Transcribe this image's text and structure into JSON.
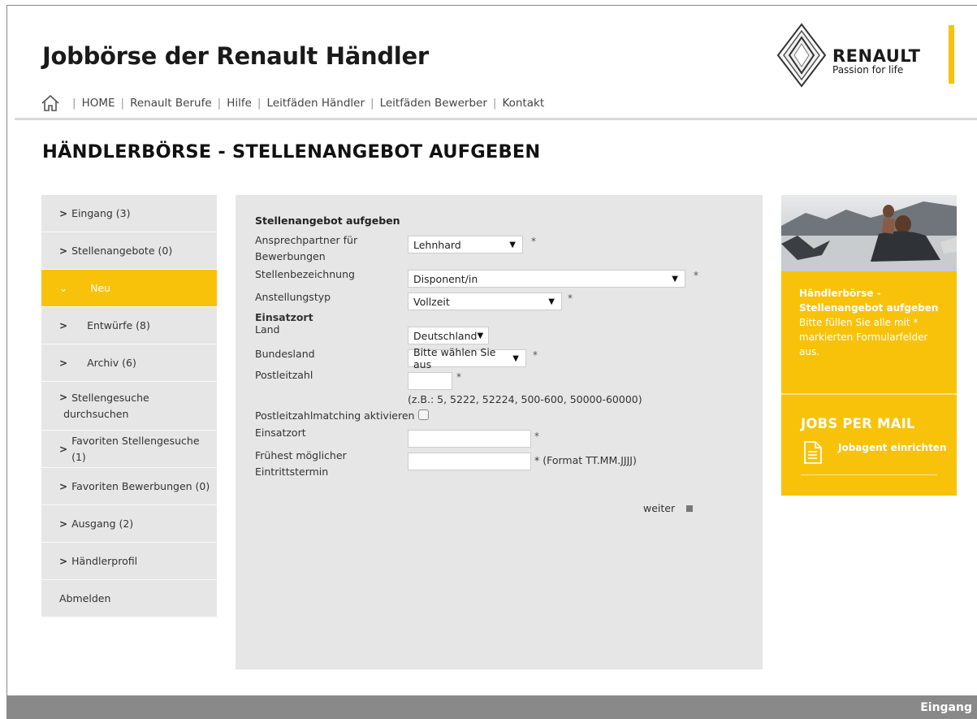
{
  "header": {
    "site_title": "Jobbörse der Renault Händler",
    "brand_name": "RENAULT",
    "brand_tagline": "Passion for life",
    "accent_color": "#f8c20b"
  },
  "topnav": {
    "home_icon": "home-icon",
    "items": [
      "HOME",
      "Renault Berufe",
      "Hilfe",
      "Leitfäden Händler",
      "Leitfäden Bewerber",
      "Kontakt"
    ]
  },
  "page_title": "HÄNDLERBÖRSE - STELLENANGEBOT AUFGEBEN",
  "sidebar": {
    "items": [
      {
        "chevron": ">",
        "label": "Eingang (3)"
      },
      {
        "chevron": ">",
        "label": "Stellenangebote (0)"
      },
      {
        "chevron": "⌄",
        "label": "Neu"
      },
      {
        "chevron": ">",
        "label": "Entwürfe (8)"
      },
      {
        "chevron": ">",
        "label": "Archiv (6)"
      },
      {
        "chevron": ">",
        "label": "Stellengesuche",
        "label2": "durchsuchen"
      },
      {
        "chevron": ">",
        "label": "Favoriten Stellengesuche (1)"
      },
      {
        "chevron": ">",
        "label": "Favoriten Bewerbungen (0)"
      },
      {
        "chevron": ">",
        "label": "Ausgang (2)"
      },
      {
        "chevron": ">",
        "label": "Händlerprofil"
      },
      {
        "chevron": "",
        "label": "Abmelden"
      }
    ]
  },
  "form": {
    "heading": "Stellenangebot aufgeben",
    "ansprechpartner": {
      "label1": "Ansprechpartner für",
      "label2": "Bewerbungen",
      "value": "Lehnhard"
    },
    "stellenbezeichnung": {
      "label": "Stellenbezeichnung",
      "value": "Disponent/in"
    },
    "anstellungstyp": {
      "label": "Anstellungstyp",
      "value": "Vollzeit"
    },
    "einsatzort_section": "Einsatzort",
    "land": {
      "label": "Land",
      "value": "Deutschland"
    },
    "bundesland": {
      "label": "Bundesland",
      "value": "Bitte wählen Sie aus"
    },
    "postleitzahl": {
      "label": "Postleitzahl",
      "value": "",
      "hint": "(z.B.: 5, 5222, 52224, 500-600, 50000-60000)"
    },
    "plz_matching": {
      "label": "Postleitzahlmatching aktivieren",
      "checked": false
    },
    "einsatzort": {
      "label": "Einsatzort",
      "value": ""
    },
    "eintrittstermin": {
      "label1": "Frühest möglicher",
      "label2": "Eintrittstermin",
      "value": "",
      "format_hint": "* (Format TT.MM.JJJJ)"
    },
    "required_marker": "*",
    "arrow": "▼",
    "weiter_label": "weiter"
  },
  "right_box": {
    "title_line1": "Händlerbörse -",
    "title_line2": "Stellenangebot aufgeben",
    "text": "Bitte füllen Sie alle mit * markierten Formularfelder aus.",
    "jobs_title": "JOBS PER MAIL",
    "jobagent_label": "Jobagent einrichten"
  },
  "footer": {
    "label": "Eingang",
    "color": "#898989"
  }
}
